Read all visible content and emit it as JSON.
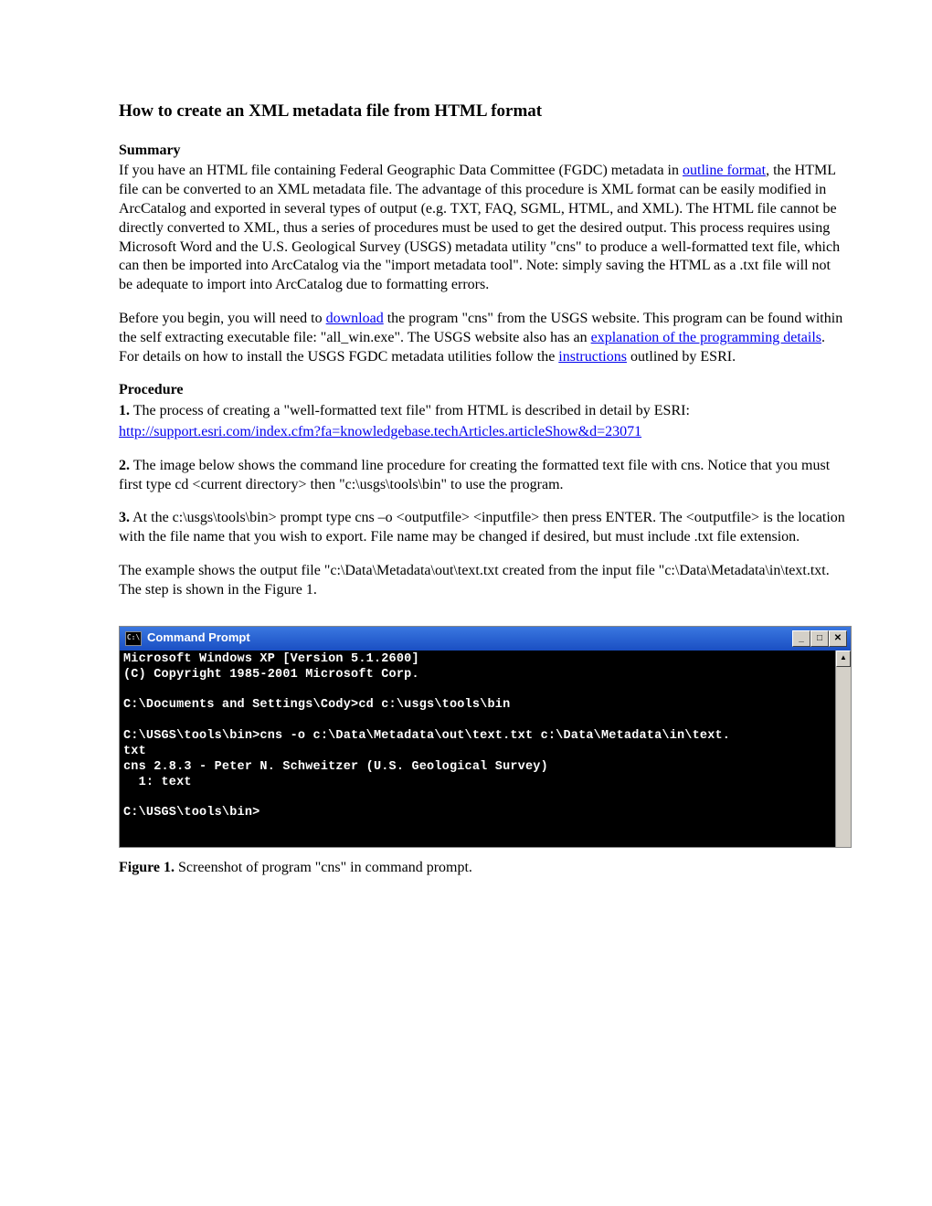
{
  "title": "How to create an XML metadata file from HTML format",
  "summary_heading": "Summary",
  "summary_p1_a": "If you have an HTML file containing Federal Geographic Data Committee (FGDC) metadata in ",
  "link_outline": "outline format",
  "summary_p1_b": ", the HTML file can be converted to an XML metadata file.  The advantage of this procedure is XML format can be easily modified in ArcCatalog and exported in several types of output (e.g. TXT, FAQ, SGML, HTML, and XML).  The HTML file cannot be directly converted to XML, thus a series of procedures must be used to get the desired output. This process requires using Microsoft Word and the U.S. Geological Survey (USGS) metadata utility \"cns\" to produce a well-formatted text file, which can then be imported into ArcCatalog via the \"import metadata tool\". Note: simply saving the HTML as a .txt file will not be adequate to import into ArcCatalog due to formatting errors.",
  "summary_p2_a": "Before you begin, you will need to ",
  "link_download": "download",
  "summary_p2_b": " the program \"cns\" from the USGS website. This program can be found within the self extracting executable file: \"all_win.exe\".  The USGS website also has an ",
  "link_explanation": "explanation of the programming details",
  "summary_p2_c": ".  For details on how to install the USGS FGDC metadata utilities follow the ",
  "link_instructions": "instructions",
  "summary_p2_d": " outlined by ESRI.",
  "procedure_heading": "Procedure",
  "step1_label": "1.",
  "step1_text": " The process of creating a \"well-formatted text file\" from HTML is described in detail by ESRI:",
  "step1_link": "http://support.esri.com/index.cfm?fa=knowledgebase.techArticles.articleShow&d=23071",
  "step2_label": "2.",
  "step2_text": "  The image below shows the command line procedure for creating the formatted text file with cns. Notice that you must first type cd <current directory> then \"c:\\usgs\\tools\\bin\" to use the program.",
  "step3_label": "3.",
  "step3_text": "  At the c:\\usgs\\tools\\bin> prompt type cns –o <outputfile> <inputfile> then press ENTER.  The <outputfile> is the location with the file name that you wish to export.  File name may be changed if desired, but must include .txt file extension.",
  "example_text": "The example shows the output file \"c:\\Data\\Metadata\\out\\text.txt created from the input file \"c:\\Data\\Metadata\\in\\text.txt. The step is shown in the Figure 1.",
  "cmd": {
    "title": "Command Prompt",
    "icon_text": "C:\\",
    "content": "Microsoft Windows XP [Version 5.1.2600]\n(C) Copyright 1985-2001 Microsoft Corp.\n\nC:\\Documents and Settings\\Cody>cd c:\\usgs\\tools\\bin\n\nC:\\USGS\\tools\\bin>cns -o c:\\Data\\Metadata\\out\\text.txt c:\\Data\\Metadata\\in\\text.\ntxt\ncns 2.8.3 - Peter N. Schweitzer (U.S. Geological Survey)\n  1: text\n\nC:\\USGS\\tools\\bin>",
    "minimize": "_",
    "maximize": "□",
    "close": "✕",
    "scroll_up": "▲",
    "scroll_down": "▼"
  },
  "figure_label": "Figure 1.",
  "figure_caption": "  Screenshot of program \"cns\" in command prompt."
}
